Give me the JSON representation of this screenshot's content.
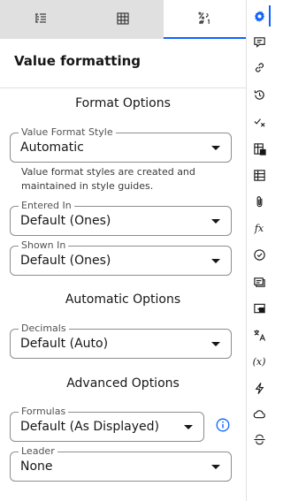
{
  "tabs": [
    {
      "name": "list-settings-tab",
      "icon": "list-settings-icon"
    },
    {
      "name": "table-tab",
      "icon": "table-grid-icon"
    },
    {
      "name": "value-format-tab",
      "icon": "percent-format-icon",
      "active": true
    }
  ],
  "panel": {
    "title": "Value formatting"
  },
  "format_options": {
    "heading": "Format Options",
    "value_format_style": {
      "label": "Value Format Style",
      "value": "Automatic"
    },
    "helper_text": "Value format styles are created and maintained in style guides.",
    "entered_in": {
      "label": "Entered In",
      "value": "Default (Ones)"
    },
    "shown_in": {
      "label": "Shown In",
      "value": "Default (Ones)"
    }
  },
  "automatic_options": {
    "heading": "Automatic Options",
    "decimals": {
      "label": "Decimals",
      "value": "Default (Auto)"
    }
  },
  "advanced_options": {
    "heading": "Advanced Options",
    "formulas": {
      "label": "Formulas",
      "value": "Default (As Displayed)"
    },
    "leader": {
      "label": "Leader",
      "value": "None"
    }
  },
  "rail": {
    "items": [
      {
        "icon": "settings-gear-icon",
        "active": true
      },
      {
        "icon": "comment-icon"
      },
      {
        "icon": "link-icon"
      },
      {
        "icon": "history-icon"
      },
      {
        "icon": "checkmark-x-icon"
      },
      {
        "icon": "calculation-sheet-icon"
      },
      {
        "icon": "data-table-icon"
      },
      {
        "icon": "attachment-icon"
      },
      {
        "icon": "function-icon",
        "text": "fx"
      },
      {
        "icon": "task-check-icon"
      },
      {
        "icon": "notes-icon"
      },
      {
        "icon": "chat-annotation-icon"
      },
      {
        "icon": "translate-icon"
      },
      {
        "icon": "variable-icon",
        "text": "(x)"
      },
      {
        "icon": "lightning-icon"
      },
      {
        "icon": "cloud-icon"
      },
      {
        "icon": "strike-through-icon"
      }
    ]
  },
  "colors": {
    "accent": "#0f62fe",
    "tab_inactive": "#e0e0e0",
    "border": "#8d8d8d"
  }
}
